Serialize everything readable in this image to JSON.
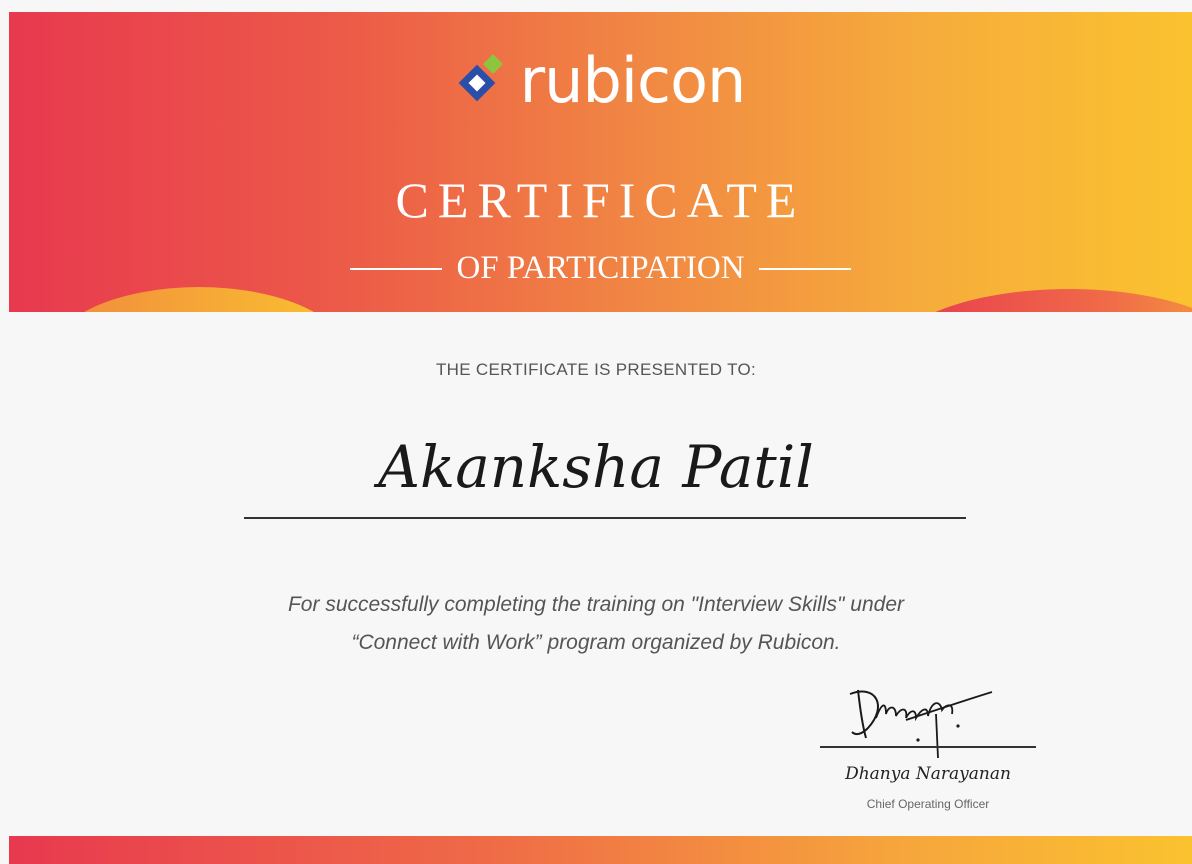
{
  "brand": {
    "name": "rubicon",
    "colors": {
      "gradient_start": "#e8394f",
      "gradient_mid": "#f18a43",
      "gradient_end": "#fbc22f",
      "logo_blue": "#2a4fa8",
      "logo_green": "#8cc63f"
    }
  },
  "certificate": {
    "title": "CERTIFICATE",
    "subtitle": "OF PARTICIPATION",
    "presented_to": "THE CERTIFICATE IS PRESENTED TO:",
    "recipient": "Akanksha Patil",
    "description_line1": "For successfully completing the training on \"Interview Skills\" under",
    "description_line2": "“Connect with Work” program organized by Rubicon."
  },
  "signatory": {
    "signature_text": "Dhanya",
    "name": "Dhanya Narayanan",
    "role": "Chief Operating Officer"
  },
  "icons": {
    "logo_mark": "rubicon-diamond-logo-icon"
  }
}
